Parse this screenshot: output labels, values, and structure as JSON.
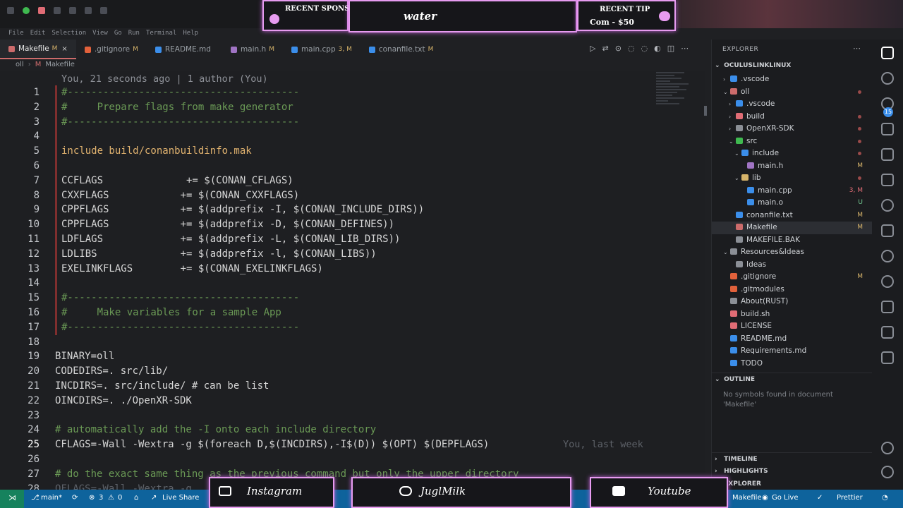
{
  "menubar": [
    "File",
    "Edit",
    "Selection",
    "View",
    "Go",
    "Run",
    "Terminal",
    "Help"
  ],
  "overlay": {
    "sponsor_label": "RECENT SPONSOR",
    "center_text": "water",
    "tip_label": "RECENT TIP",
    "tip_value": "Com - $50",
    "instagram": "Instagram",
    "twitter": "JuglMilk",
    "youtube": "Youtube",
    "accent": "#e79bf0"
  },
  "tabs": [
    {
      "label": "Makefile",
      "status": "M",
      "active": true,
      "icon_color": "#cc6b6b"
    },
    {
      "label": ".gitignore",
      "status": "M",
      "active": false,
      "icon_color": "#e2613b"
    },
    {
      "label": "README.md",
      "status": "",
      "active": false,
      "icon_color": "#3b8eea"
    },
    {
      "label": "main.h",
      "status": "M",
      "active": false,
      "icon_color": "#a074c4"
    },
    {
      "label": "main.cpp",
      "status": "3, M",
      "active": false,
      "icon_color": "#3b8eea"
    },
    {
      "label": "conanfile.txt",
      "status": "M",
      "active": false,
      "icon_color": "#3b8eea"
    }
  ],
  "breadcrumb": [
    "oll",
    "Makefile"
  ],
  "editor": {
    "blame_header": "You, 21 seconds ago | 1 author (You)",
    "inline_blame": "You, last week",
    "current_line": 25,
    "lines": [
      "#---------------------------------------",
      "#     Prepare flags from make generator",
      "#---------------------------------------",
      "",
      "include build/conanbuildinfo.mak",
      "",
      "CCFLAGS              += $(CONAN_CFLAGS)",
      "CXXFLAGS            += $(CONAN_CXXFLAGS)",
      "CPPFLAGS            += $(addprefix -I, $(CONAN_INCLUDE_DIRS))",
      "CPPFLAGS            += $(addprefix -D, $(CONAN_DEFINES))",
      "LDFLAGS             += $(addprefix -L, $(CONAN_LIB_DIRS))",
      "LDLIBS              += $(addprefix -l, $(CONAN_LIBS))",
      "EXELINKFLAGS        += $(CONAN_EXELINKFLAGS)",
      "",
      "#---------------------------------------",
      "#     Make variables for a sample App",
      "#---------------------------------------",
      "",
      "BINARY=oll",
      "CODEDIRS=. src/lib/",
      "INCDIRS=. src/include/ # can be list",
      "OINCDIRS=. ./OpenXR-SDK",
      "",
      "# automatically add the -I onto each include directory",
      "CFLAGS=-Wall -Wextra -g $(foreach D,$(INCDIRS),-I$(D)) $(OPT) $(DEPFLAGS)",
      "",
      "# do the exact same thing as the previous command but only the upper directory",
      "OFLAGS=-Wall -Wextra -g"
    ]
  },
  "explorer": {
    "title": "EXPLORER",
    "root": "OCULUSLINKLINUX",
    "items": [
      {
        "label": ".vscode",
        "depth": 1,
        "kind": "folder",
        "chev": "›",
        "color": "#3b8eea",
        "status": ""
      },
      {
        "label": "oll",
        "depth": 1,
        "kind": "folder",
        "chev": "⌄",
        "color": "#cc6b6b",
        "status": "dot"
      },
      {
        "label": ".vscode",
        "depth": 2,
        "kind": "folder",
        "chev": "›",
        "color": "#3b8eea",
        "status": ""
      },
      {
        "label": "build",
        "depth": 2,
        "kind": "folder",
        "chev": "›",
        "color": "#e06c75",
        "status": "dot"
      },
      {
        "label": "OpenXR-SDK",
        "depth": 2,
        "kind": "folder",
        "chev": "›",
        "color": "#8b8f96",
        "status": "dot"
      },
      {
        "label": "src",
        "depth": 2,
        "kind": "folder",
        "chev": "⌄",
        "color": "#3fb950",
        "status": "dot"
      },
      {
        "label": "include",
        "depth": 3,
        "kind": "folder",
        "chev": "⌄",
        "color": "#3b8eea",
        "status": "dot"
      },
      {
        "label": "main.h",
        "depth": 4,
        "kind": "file",
        "chev": "",
        "color": "#a074c4",
        "status": "M"
      },
      {
        "label": "lib",
        "depth": 3,
        "kind": "folder",
        "chev": "⌄",
        "color": "#d7b46a",
        "status": "dot"
      },
      {
        "label": "main.cpp",
        "depth": 4,
        "kind": "file",
        "chev": "",
        "color": "#3b8eea",
        "status": "3, M"
      },
      {
        "label": "main.o",
        "depth": 4,
        "kind": "file",
        "chev": "",
        "color": "#3b8eea",
        "status": "U"
      },
      {
        "label": "conanfile.txt",
        "depth": 2,
        "kind": "file",
        "chev": "",
        "color": "#3b8eea",
        "status": "M"
      },
      {
        "label": "Makefile",
        "depth": 2,
        "kind": "file",
        "chev": "",
        "color": "#cc6b6b",
        "status": "M",
        "selected": true
      },
      {
        "label": "MAKEFILE.BAK",
        "depth": 2,
        "kind": "file",
        "chev": "",
        "color": "#8b8f96",
        "status": ""
      },
      {
        "label": "Resources&Ideas",
        "depth": 1,
        "kind": "folder",
        "chev": "⌄",
        "color": "#8b8f96",
        "status": ""
      },
      {
        "label": "Ideas",
        "depth": 2,
        "kind": "file",
        "chev": "",
        "color": "#8b8f96",
        "status": ""
      },
      {
        "label": ".gitignore",
        "depth": 1,
        "kind": "file",
        "chev": "",
        "color": "#e2613b",
        "status": "M"
      },
      {
        "label": ".gitmodules",
        "depth": 1,
        "kind": "file",
        "chev": "",
        "color": "#e2613b",
        "status": ""
      },
      {
        "label": "About(RUST)",
        "depth": 1,
        "kind": "file",
        "chev": "",
        "color": "#8b8f96",
        "status": ""
      },
      {
        "label": "build.sh",
        "depth": 1,
        "kind": "file",
        "chev": "",
        "color": "#e06c75",
        "status": ""
      },
      {
        "label": "LICENSE",
        "depth": 1,
        "kind": "file",
        "chev": "",
        "color": "#e06c75",
        "status": ""
      },
      {
        "label": "README.md",
        "depth": 1,
        "kind": "file",
        "chev": "",
        "color": "#3b8eea",
        "status": ""
      },
      {
        "label": "Requirements.md",
        "depth": 1,
        "kind": "file",
        "chev": "",
        "color": "#3b8eea",
        "status": ""
      },
      {
        "label": "TODO",
        "depth": 1,
        "kind": "file",
        "chev": "",
        "color": "#3b8eea",
        "status": ""
      }
    ],
    "outline_title": "OUTLINE",
    "outline_msg": "No symbols found in document 'Makefile'",
    "timeline": "TIMELINE",
    "highlights": "HIGHLIGHTS",
    "explorer2": "EXPLORER",
    "scm_badge": "15"
  },
  "statusbar": {
    "branch": "main*",
    "errors": "3",
    "warnings": "0",
    "live_share": "Live Share",
    "language": "Makefile",
    "go_live": "Go Live",
    "prettier": "Prettier"
  }
}
